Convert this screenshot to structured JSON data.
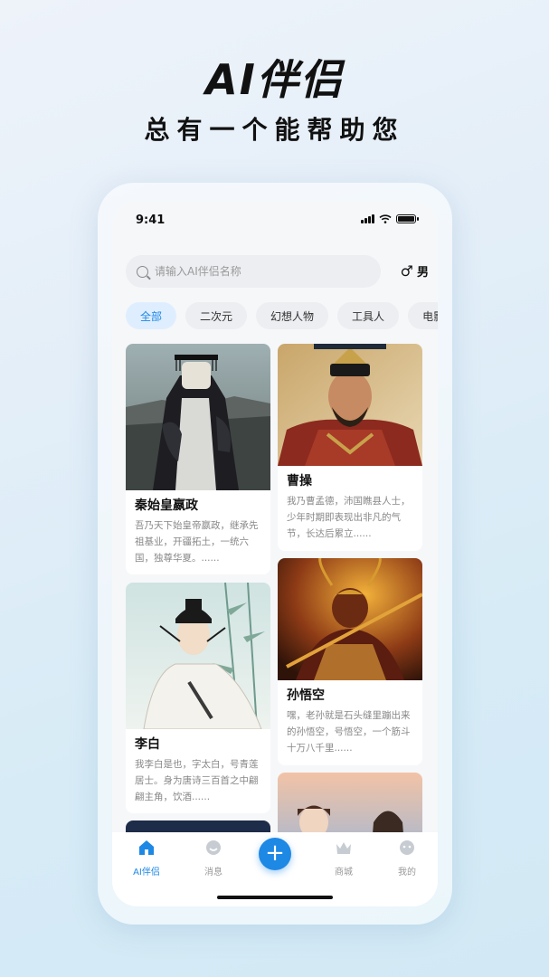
{
  "promo": {
    "title": "AI伴侣",
    "subtitle": "总有一个能帮助您"
  },
  "status_bar": {
    "time": "9:41"
  },
  "search": {
    "placeholder": "请输入AI伴侣名称"
  },
  "gender": {
    "symbol": "♂",
    "label": "男"
  },
  "tabs": [
    {
      "label": "全部",
      "active": true
    },
    {
      "label": "二次元"
    },
    {
      "label": "幻想人物"
    },
    {
      "label": "工具人"
    },
    {
      "label": "电影"
    }
  ],
  "cards": [
    {
      "title": "秦始皇嬴政",
      "desc": "吾乃天下始皇帝嬴政，继承先祖基业，开疆拓土，一统六国，独尊华夏。......"
    },
    {
      "title": "曹操",
      "desc": "我乃曹孟德，沛国瞧县人士，少年时期即表现出非凡的气节，长达后累立......"
    },
    {
      "title": "李白",
      "desc": "我李白是也，字太白，号青莲居士。身为唐诗三百首之中翩翩主角，饮酒......"
    },
    {
      "title": "孙悟空",
      "desc": "嘿，老孙就是石头缝里蹦出来的孙悟空，号悟空，一个筋斗十万八千里......"
    }
  ],
  "nav": {
    "home": "AI伴侣",
    "messages": "消息",
    "add": "+",
    "store": "商城",
    "profile": "我的"
  },
  "colors": {
    "accent": "#1e88e5"
  }
}
